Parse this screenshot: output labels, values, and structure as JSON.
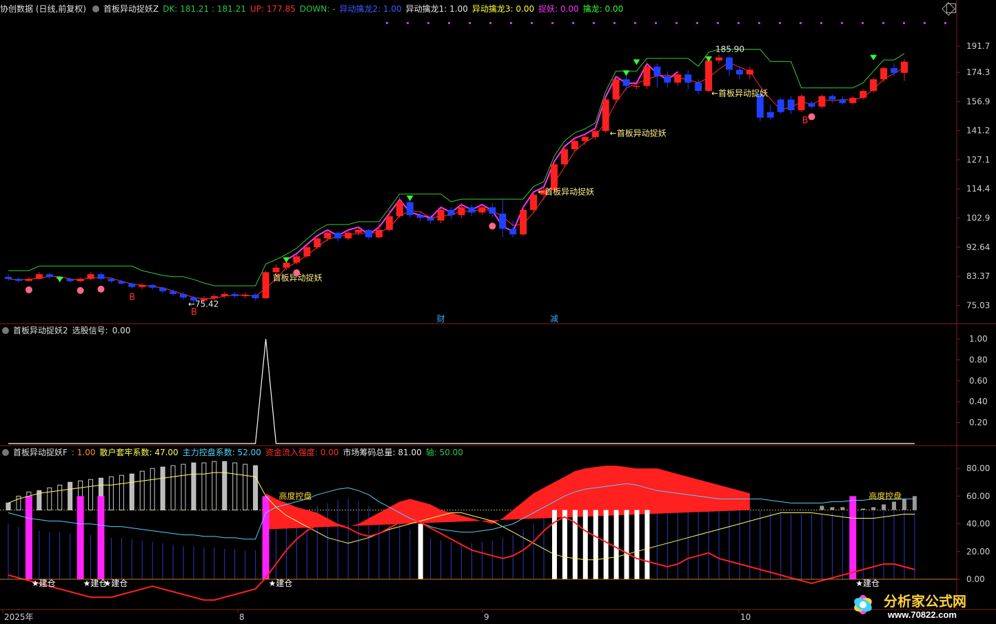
{
  "header": {
    "app_title": "协创数据 (日线,前复权)",
    "indicator_name": "首板异动捉妖Z",
    "items": [
      {
        "label": "DK:",
        "value": "181.21 : 181.21",
        "color": "#29c94a"
      },
      {
        "label": "UP:",
        "value": "177.85",
        "color": "#ff3030"
      },
      {
        "label": "DOWN:",
        "value": "-",
        "color": "#29c94a"
      },
      {
        "label": "异动擒龙2:",
        "value": "1.00",
        "color": "#3b5bff"
      },
      {
        "label": "异动擒龙1:",
        "value": "1.00",
        "color": "#e8e8e8"
      },
      {
        "label": "异动擒龙3:",
        "value": "0.00",
        "color": "#ffff33"
      },
      {
        "label": "捉妖:",
        "value": "0.00",
        "color": "#ff33ff"
      },
      {
        "label": "擒龙:",
        "value": "0.00",
        "color": "#33ff33"
      }
    ]
  },
  "panel2": {
    "title": "首板异动捉妖2",
    "signal_label": "选股信号:",
    "signal_value": "0.00"
  },
  "panel3": {
    "title": "首板异动捉妖F",
    "items": [
      {
        "label": ":",
        "value": "1.00",
        "color": "#ff8c2a"
      },
      {
        "label": "散户套牢系数:",
        "value": "47.00",
        "color": "#ffff55"
      },
      {
        "label": "主力控盘系数:",
        "value": "52.00",
        "color": "#4fd6ff"
      },
      {
        "label": "资金流入强度:",
        "value": "0.00",
        "color": "#ff3030"
      },
      {
        "label": "市场筹码总量:",
        "value": "81.00",
        "color": "#e8e8e8"
      },
      {
        "label": "轴:",
        "value": "50.00",
        "color": "#29c94a"
      }
    ]
  },
  "price_axis": [
    "191.7",
    "174.3",
    "156.9",
    "141.2",
    "127.1",
    "114.4",
    "102.9",
    "92.64",
    "83.37",
    "75.03"
  ],
  "signal_axis": [
    "1.00",
    "0.80",
    "0.60",
    "0.40",
    "0.20"
  ],
  "control_axis": [
    "80.00",
    "60.00",
    "40.00",
    "20.00",
    "0.00"
  ],
  "date_axis": [
    "2025年",
    "8",
    "9",
    "10"
  ],
  "annotations": {
    "first_board": "←首板异动捉妖",
    "first_board_left": "首板异动捉妖",
    "low_price": "←75.42",
    "high_price": "185.90",
    "buy_mark": "B",
    "cai": "财",
    "jian": "减",
    "build": "建仓",
    "height_control": "高度控盘"
  },
  "watermark": {
    "text": "分析家公式网",
    "url": "www.70822.com"
  },
  "colors": {
    "up": "#ff2020",
    "down": "#2040ff",
    "magenta": "#ff33ff",
    "green": "#33ff33"
  },
  "chart_data": {
    "type": "candlestick",
    "candles": [
      {
        "o": 83.2,
        "c": 82.6,
        "h": 84.0,
        "l": 82.0
      },
      {
        "o": 82.6,
        "c": 82.0,
        "h": 83.0,
        "l": 81.5
      },
      {
        "o": 82.0,
        "c": 82.6,
        "h": 83.2,
        "l": 81.8
      },
      {
        "o": 82.6,
        "c": 84.0,
        "h": 84.6,
        "l": 82.3
      },
      {
        "o": 84.0,
        "c": 83.2,
        "h": 84.5,
        "l": 82.6
      },
      {
        "o": 83.2,
        "c": 82.6,
        "h": 83.5,
        "l": 82.0
      },
      {
        "o": 82.6,
        "c": 81.9,
        "h": 83.0,
        "l": 81.5
      },
      {
        "o": 81.9,
        "c": 82.6,
        "h": 83.0,
        "l": 81.6
      },
      {
        "o": 82.6,
        "c": 84.0,
        "h": 84.6,
        "l": 82.2
      },
      {
        "o": 84.0,
        "c": 82.6,
        "h": 84.6,
        "l": 82.0
      },
      {
        "o": 82.6,
        "c": 81.9,
        "h": 83.0,
        "l": 81.4
      },
      {
        "o": 81.9,
        "c": 81.2,
        "h": 82.4,
        "l": 80.8
      },
      {
        "o": 81.2,
        "c": 80.2,
        "h": 81.6,
        "l": 79.8
      },
      {
        "o": 80.2,
        "c": 80.8,
        "h": 81.2,
        "l": 79.6
      },
      {
        "o": 80.8,
        "c": 80.0,
        "h": 81.0,
        "l": 79.4
      },
      {
        "o": 80.0,
        "c": 79.0,
        "h": 80.4,
        "l": 78.4
      },
      {
        "o": 79.0,
        "c": 78.2,
        "h": 79.6,
        "l": 77.6
      },
      {
        "o": 78.2,
        "c": 77.2,
        "h": 78.8,
        "l": 76.6
      },
      {
        "o": 77.2,
        "c": 76.4,
        "h": 77.8,
        "l": 75.42
      },
      {
        "o": 76.4,
        "c": 77.0,
        "h": 77.6,
        "l": 75.8
      },
      {
        "o": 77.0,
        "c": 77.6,
        "h": 78.2,
        "l": 76.4
      },
      {
        "o": 77.6,
        "c": 78.2,
        "h": 78.8,
        "l": 77.0
      },
      {
        "o": 78.2,
        "c": 77.6,
        "h": 78.8,
        "l": 77.0
      },
      {
        "o": 77.6,
        "c": 78.0,
        "h": 78.6,
        "l": 77.0
      },
      {
        "o": 78.0,
        "c": 77.0,
        "h": 78.4,
        "l": 76.4
      },
      {
        "o": 77.0,
        "c": 84.6,
        "h": 85.0,
        "l": 76.8
      },
      {
        "o": 84.6,
        "c": 86.0,
        "h": 87.0,
        "l": 83.4
      },
      {
        "o": 86.0,
        "c": 87.6,
        "h": 88.4,
        "l": 85.2
      },
      {
        "o": 87.6,
        "c": 89.6,
        "h": 90.4,
        "l": 87.0
      },
      {
        "o": 89.6,
        "c": 92.6,
        "h": 93.6,
        "l": 89.0
      },
      {
        "o": 92.6,
        "c": 95.6,
        "h": 96.6,
        "l": 92.0
      },
      {
        "o": 95.6,
        "c": 97.6,
        "h": 98.6,
        "l": 94.6
      },
      {
        "o": 97.6,
        "c": 95.6,
        "h": 98.2,
        "l": 94.6
      },
      {
        "o": 95.6,
        "c": 97.6,
        "h": 98.6,
        "l": 95.0
      },
      {
        "o": 97.6,
        "c": 98.6,
        "h": 99.6,
        "l": 96.6
      },
      {
        "o": 98.6,
        "c": 96.0,
        "h": 99.0,
        "l": 95.2
      },
      {
        "o": 96.0,
        "c": 98.6,
        "h": 101.0,
        "l": 95.6
      },
      {
        "o": 98.6,
        "c": 103.6,
        "h": 106.0,
        "l": 98.0
      },
      {
        "o": 103.6,
        "c": 109.0,
        "h": 111.0,
        "l": 103.0
      },
      {
        "o": 109.0,
        "c": 104.0,
        "h": 110.0,
        "l": 103.0
      },
      {
        "o": 104.0,
        "c": 103.0,
        "h": 105.6,
        "l": 101.6
      },
      {
        "o": 103.0,
        "c": 102.0,
        "h": 104.0,
        "l": 101.0
      },
      {
        "o": 102.0,
        "c": 106.0,
        "h": 107.0,
        "l": 101.0
      },
      {
        "o": 106.0,
        "c": 104.0,
        "h": 107.0,
        "l": 102.6
      },
      {
        "o": 104.0,
        "c": 107.0,
        "h": 108.6,
        "l": 103.0
      },
      {
        "o": 107.0,
        "c": 105.0,
        "h": 108.0,
        "l": 103.6
      },
      {
        "o": 105.0,
        "c": 107.0,
        "h": 108.0,
        "l": 104.0
      },
      {
        "o": 107.0,
        "c": 104.6,
        "h": 108.6,
        "l": 103.0
      },
      {
        "o": 104.6,
        "c": 99.0,
        "h": 110.0,
        "l": 96.0
      },
      {
        "o": 99.0,
        "c": 97.0,
        "h": 102.0,
        "l": 96.0
      },
      {
        "o": 97.0,
        "c": 106.0,
        "h": 107.0,
        "l": 96.6
      },
      {
        "o": 106.0,
        "c": 112.0,
        "h": 113.0,
        "l": 105.0
      },
      {
        "o": 112.0,
        "c": 114.0,
        "h": 115.0,
        "l": 110.0
      },
      {
        "o": 114.0,
        "c": 125.0,
        "h": 126.0,
        "l": 113.0
      },
      {
        "o": 125.0,
        "c": 132.0,
        "h": 133.6,
        "l": 124.0
      },
      {
        "o": 132.0,
        "c": 136.0,
        "h": 138.0,
        "l": 131.0
      },
      {
        "o": 136.0,
        "c": 138.0,
        "h": 139.0,
        "l": 134.0
      },
      {
        "o": 138.0,
        "c": 141.0,
        "h": 142.6,
        "l": 136.6
      },
      {
        "o": 141.0,
        "c": 158.0,
        "h": 159.0,
        "l": 140.0
      },
      {
        "o": 158.0,
        "c": 170.0,
        "h": 172.0,
        "l": 156.0
      },
      {
        "o": 170.0,
        "c": 166.0,
        "h": 172.6,
        "l": 163.0
      },
      {
        "o": 166.0,
        "c": 166.0,
        "h": 168.0,
        "l": 164.0
      },
      {
        "o": 166.0,
        "c": 178.0,
        "h": 181.0,
        "l": 164.0
      },
      {
        "o": 178.0,
        "c": 172.0,
        "h": 180.0,
        "l": 165.0
      },
      {
        "o": 172.0,
        "c": 168.0,
        "h": 175.0,
        "l": 165.0
      },
      {
        "o": 168.0,
        "c": 173.0,
        "h": 175.0,
        "l": 166.0
      },
      {
        "o": 173.0,
        "c": 168.0,
        "h": 176.0,
        "l": 164.0
      },
      {
        "o": 168.0,
        "c": 163.0,
        "h": 170.0,
        "l": 161.0
      },
      {
        "o": 163.0,
        "c": 182.0,
        "h": 184.0,
        "l": 162.0
      },
      {
        "o": 182.0,
        "c": 184.0,
        "h": 185.9,
        "l": 180.0
      },
      {
        "o": 184.0,
        "c": 176.0,
        "h": 185.0,
        "l": 172.0
      },
      {
        "o": 176.0,
        "c": 173.0,
        "h": 178.0,
        "l": 170.0
      },
      {
        "o": 173.0,
        "c": 176.0,
        "h": 178.0,
        "l": 170.0
      },
      {
        "o": 161.0,
        "c": 148.0,
        "h": 162.0,
        "l": 146.0
      },
      {
        "o": 148.0,
        "c": 151.0,
        "h": 155.0,
        "l": 147.0
      },
      {
        "o": 151.0,
        "c": 158.0,
        "h": 159.0,
        "l": 150.0
      },
      {
        "o": 158.0,
        "c": 152.0,
        "h": 160.0,
        "l": 150.0
      },
      {
        "o": 152.0,
        "c": 160.0,
        "h": 161.0,
        "l": 151.0
      },
      {
        "o": 156.0,
        "c": 154.0,
        "h": 157.0,
        "l": 153.0
      },
      {
        "o": 154.0,
        "c": 160.0,
        "h": 161.0,
        "l": 153.0
      },
      {
        "o": 160.0,
        "c": 158.0,
        "h": 161.0,
        "l": 156.0
      },
      {
        "o": 158.0,
        "c": 156.0,
        "h": 160.0,
        "l": 155.0
      },
      {
        "o": 156.0,
        "c": 159.0,
        "h": 160.0,
        "l": 155.0
      },
      {
        "o": 159.0,
        "c": 163.0,
        "h": 164.0,
        "l": 158.0
      },
      {
        "o": 163.0,
        "c": 170.0,
        "h": 171.0,
        "l": 162.0
      },
      {
        "o": 170.0,
        "c": 177.0,
        "h": 178.0,
        "l": 168.0
      },
      {
        "o": 177.0,
        "c": 174.0,
        "h": 180.0,
        "l": 172.0
      },
      {
        "o": 174.0,
        "c": 181.2,
        "h": 183.0,
        "l": 169.0
      }
    ],
    "signal_series": [
      0,
      0,
      0,
      0,
      0,
      0,
      0,
      0,
      0,
      0,
      0,
      0,
      0,
      0,
      0,
      0,
      0,
      0,
      0,
      0,
      0,
      0,
      0,
      0,
      0,
      1,
      0,
      0,
      0,
      0,
      0,
      0,
      0,
      0,
      0,
      0,
      0,
      0,
      0,
      0,
      0,
      0,
      0,
      0,
      0,
      0,
      0,
      0,
      0,
      0,
      0,
      0,
      0,
      0,
      0,
      0,
      0,
      0,
      0,
      0,
      0,
      0,
      0,
      0,
      0,
      0,
      0,
      0,
      0,
      0,
      0,
      0,
      0,
      0,
      0,
      0,
      0,
      0,
      0,
      0,
      0,
      0,
      0,
      0,
      0,
      0,
      0,
      0,
      0
    ],
    "market_chip_series": [
      55,
      60,
      63,
      64,
      66,
      68,
      70,
      71,
      72,
      73,
      74,
      75,
      76,
      78,
      80,
      81,
      82,
      83,
      84,
      84,
      85,
      85,
      84,
      83,
      82,
      62,
      58,
      55,
      52,
      50,
      48,
      44,
      40,
      38,
      40,
      44,
      48,
      52,
      56,
      58,
      56,
      54,
      50,
      48,
      46,
      44,
      42,
      40,
      44,
      50,
      56,
      62,
      66,
      70,
      74,
      78,
      80,
      81,
      82,
      82,
      81,
      80,
      80,
      80,
      78,
      76,
      74,
      72,
      70,
      68,
      66,
      64,
      62,
      60,
      58,
      58,
      56,
      55,
      54,
      53,
      52,
      52,
      51,
      51,
      52,
      54,
      56,
      58,
      60
    ],
    "main_control_series": [
      40,
      38,
      36,
      35,
      34,
      34,
      33,
      32,
      32,
      31,
      30,
      30,
      29,
      28,
      27,
      26,
      25,
      24,
      24,
      23,
      23,
      22,
      22,
      21,
      21,
      40,
      44,
      46,
      48,
      50,
      53,
      55,
      57,
      58,
      56,
      53,
      48,
      44,
      40,
      36,
      33,
      30,
      28,
      27,
      26,
      26,
      27,
      28,
      30,
      32,
      36,
      40,
      44,
      48,
      52,
      55,
      57,
      58,
      59,
      60,
      61,
      60,
      58,
      56,
      55,
      54,
      53,
      52,
      51,
      50,
      50,
      50,
      50,
      50,
      49,
      48,
      47,
      47,
      47,
      47,
      48,
      48,
      49,
      49,
      50,
      50,
      50,
      50,
      50
    ],
    "retail_series": [
      55,
      58,
      60,
      62,
      63,
      64,
      65,
      66,
      67,
      68,
      68,
      69,
      70,
      71,
      72,
      73,
      74,
      75,
      76,
      76,
      77,
      77,
      76,
      75,
      74,
      60,
      52,
      46,
      42,
      38,
      34,
      30,
      28,
      26,
      28,
      30,
      33,
      36,
      38,
      40,
      42,
      44,
      46,
      48,
      48,
      46,
      44,
      42,
      38,
      34,
      30,
      26,
      22,
      18,
      16,
      15,
      14,
      14,
      15,
      16,
      18,
      20,
      22,
      24,
      26,
      28,
      30,
      32,
      34,
      36,
      38,
      40,
      42,
      44,
      46,
      48,
      48,
      48,
      48,
      47,
      46,
      45,
      44,
      44,
      44,
      45,
      46,
      47,
      47
    ],
    "flow_series": [
      -2,
      -4,
      -6,
      -8,
      -10,
      -12,
      -14,
      -16,
      -18,
      -18,
      -18,
      -16,
      -14,
      -12,
      -10,
      -12,
      -14,
      -16,
      -18,
      -20,
      -20,
      -18,
      -16,
      -14,
      -12,
      -4,
      6,
      16,
      24,
      30,
      34,
      36,
      34,
      32,
      28,
      26,
      28,
      32,
      36,
      38,
      36,
      32,
      28,
      24,
      20,
      16,
      14,
      12,
      10,
      12,
      16,
      22,
      30,
      36,
      40,
      36,
      30,
      26,
      22,
      18,
      14,
      10,
      8,
      6,
      4,
      6,
      10,
      12,
      14,
      10,
      8,
      6,
      4,
      2,
      0,
      -2,
      -4,
      -6,
      -8,
      -6,
      -4,
      -2,
      0,
      2,
      4,
      6,
      6,
      4,
      2
    ]
  }
}
